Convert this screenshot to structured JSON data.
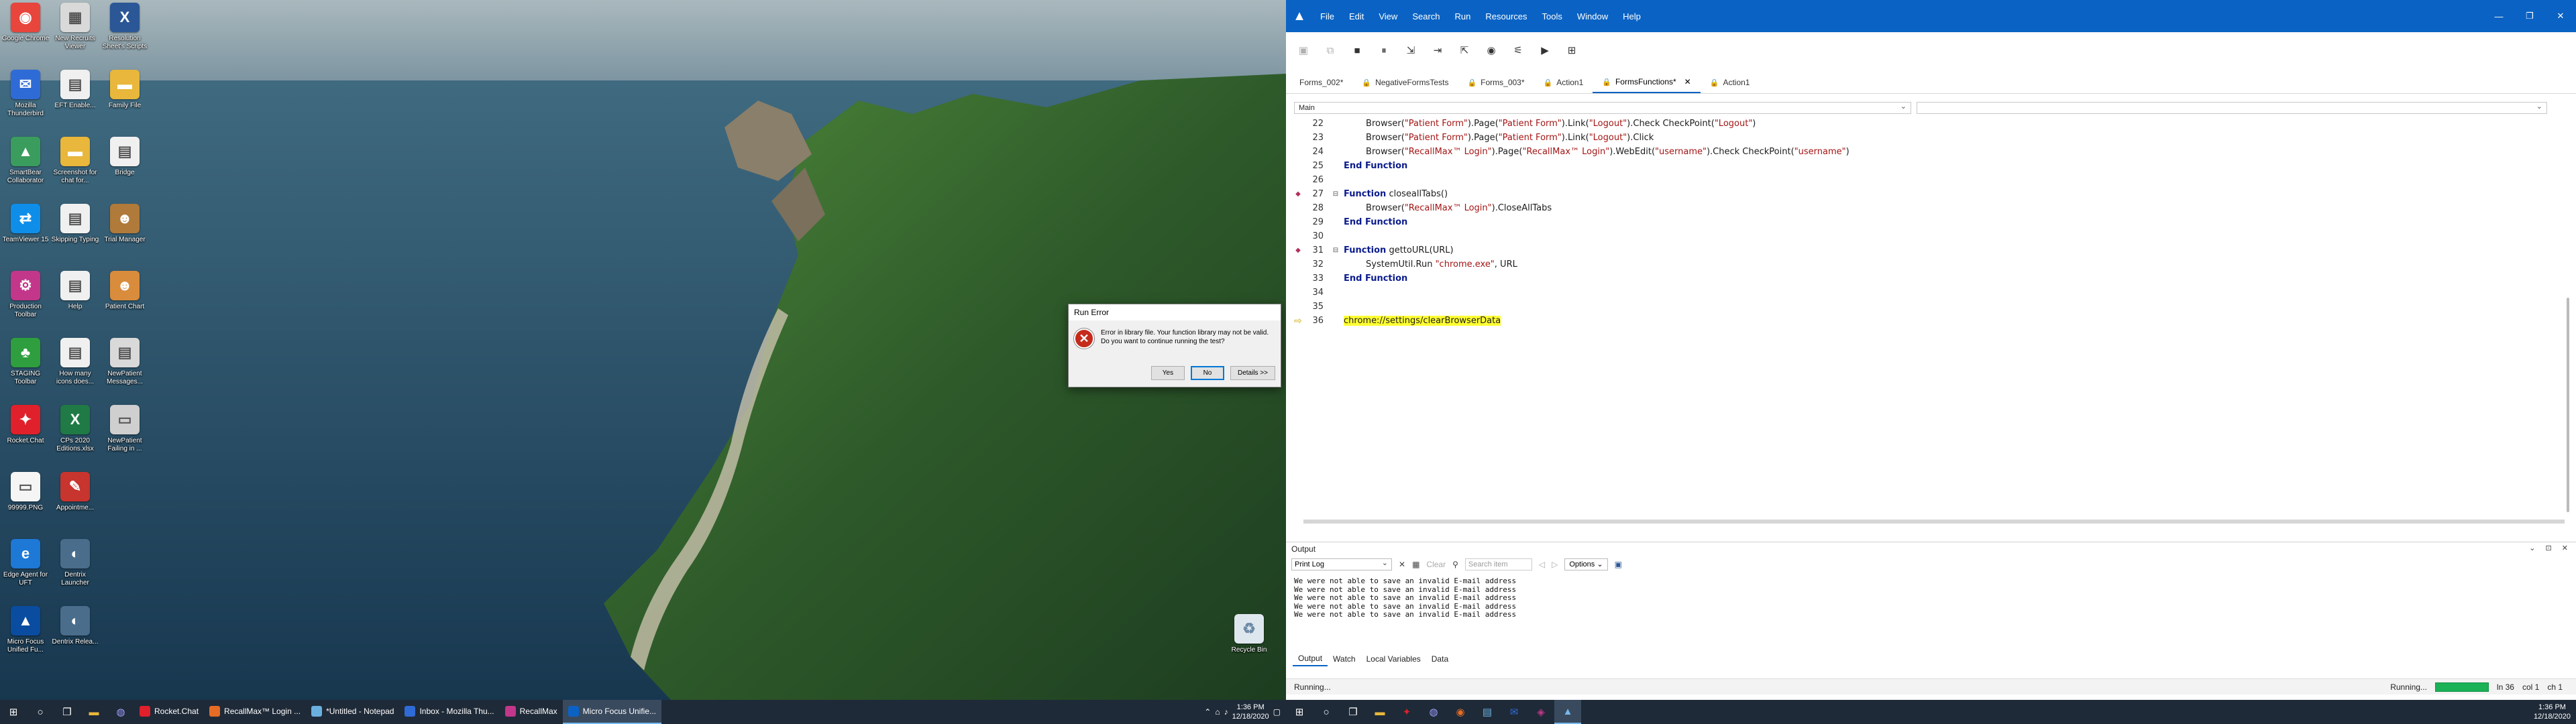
{
  "desktop": {
    "icons": [
      {
        "label": "Google Chrome",
        "icon": "chrome-icon",
        "color": "#e8453c",
        "glyph": "◉"
      },
      {
        "label": "New Recruits Viewer",
        "icon": "spreadsheet-icon",
        "color": "#d9d9d9",
        "glyph": "▦"
      },
      {
        "label": "Resolution Sheet's Scripts",
        "icon": "x-app-icon",
        "color": "#2b5797",
        "glyph": "X"
      },
      {
        "label": "Mozilla Thunderbird",
        "icon": "thunderbird-icon",
        "color": "#2f6bd6",
        "glyph": "✉"
      },
      {
        "label": "EFT Enable...",
        "icon": "document-icon",
        "color": "#f0f0f0",
        "glyph": "▤"
      },
      {
        "label": "Family File",
        "icon": "folder-icon",
        "color": "#e8b73b",
        "glyph": "▬"
      },
      {
        "label": "SmartBear Collaborator",
        "icon": "smartbear-icon",
        "color": "#3a9d5d",
        "glyph": "▲"
      },
      {
        "label": "Screenshot for chat for...",
        "icon": "folder-icon",
        "color": "#e8b73b",
        "glyph": "▬"
      },
      {
        "label": "Bridge",
        "icon": "document-icon",
        "color": "#f0f0f0",
        "glyph": "▤"
      },
      {
        "label": "TeamViewer 15",
        "icon": "teamviewer-icon",
        "color": "#0e8ee9",
        "glyph": "⇄"
      },
      {
        "label": "Skipping Typing",
        "icon": "document-icon",
        "color": "#f0f0f0",
        "glyph": "▤"
      },
      {
        "label": "Trial Manager",
        "icon": "person-icon",
        "color": "#b07a3a",
        "glyph": "☻"
      },
      {
        "label": "Production Toolbar",
        "icon": "production-icon",
        "color": "#c2378a",
        "glyph": "⚙"
      },
      {
        "label": "Help",
        "icon": "document-icon",
        "color": "#f0f0f0",
        "glyph": "▤"
      },
      {
        "label": "Patient Chart",
        "icon": "person-icon",
        "color": "#d98c3c",
        "glyph": "☻"
      },
      {
        "label": "STAGING Toolbar",
        "icon": "tree-icon",
        "color": "#2e9e3e",
        "glyph": "♣"
      },
      {
        "label": "How many icons does...",
        "icon": "document-icon",
        "color": "#f0f0f0",
        "glyph": "▤"
      },
      {
        "label": "NewPatient Messages...",
        "icon": "document-icon",
        "color": "#d9d9d9",
        "glyph": "▤"
      },
      {
        "label": "Rocket.Chat",
        "icon": "rocketchat-icon",
        "color": "#e0202a",
        "glyph": "✦"
      },
      {
        "label": "CPs 2020 Editions.xlsx",
        "icon": "excel-icon",
        "color": "#1f7a45",
        "glyph": "X"
      },
      {
        "label": "NewPatient Failing in ...",
        "icon": "image-icon",
        "color": "#cfcfcf",
        "glyph": "▭"
      },
      {
        "label": "99999.PNG",
        "icon": "image-icon",
        "color": "#f5f5f5",
        "glyph": "▭"
      },
      {
        "label": "Appointme...",
        "icon": "appointment-icon",
        "color": "#c8342e",
        "glyph": "✎"
      },
      {
        "label": "Edge Agent for UFT",
        "icon": "edge-icon",
        "color": "#1d78d6",
        "glyph": "e"
      },
      {
        "label": "Dentrix Launcher",
        "icon": "dentrix-icon",
        "color": "#4a6d8c",
        "glyph": "◐"
      },
      {
        "label": "Micro Focus Unified Fu...",
        "icon": "microfocus-icon",
        "color": "#0a4ca0",
        "glyph": "▲"
      },
      {
        "label": "Dentrix Relea...",
        "icon": "dentrix-icon",
        "color": "#4a6d8c",
        "glyph": "◐"
      }
    ],
    "recycle_bin": "Recycle Bin"
  },
  "dialog": {
    "title": "Run Error",
    "message": "Error in library file. Your function library may not be valid.\nDo you want to continue running the test?",
    "yes": "Yes",
    "no": "No",
    "details": "Details >>"
  },
  "taskbar_left": {
    "apps": [
      {
        "label": "Rocket.Chat",
        "color": "#e0202a"
      },
      {
        "label": "RecallMax™ Login ...",
        "color": "#e66b24"
      },
      {
        "label": "*Untitled - Notepad",
        "color": "#6ab0de"
      },
      {
        "label": "Inbox - Mozilla Thu...",
        "color": "#2f6bd6"
      },
      {
        "label": "RecallMax",
        "color": "#c2378a"
      },
      {
        "label": "Micro Focus Unifie...",
        "color": "#0a63c4"
      }
    ],
    "time": "1:36 PM",
    "date": "12/18/2020"
  },
  "app": {
    "menu": [
      "File",
      "Edit",
      "View",
      "Search",
      "Run",
      "Resources",
      "Tools",
      "Window",
      "Help"
    ],
    "tabs": [
      {
        "label": "Forms_002*",
        "locked": false,
        "close": false
      },
      {
        "label": "NegativeFormsTests",
        "locked": true,
        "close": false
      },
      {
        "label": "Forms_003*",
        "locked": true,
        "close": false
      },
      {
        "label": "Action1",
        "locked": true,
        "close": false
      },
      {
        "label": "FormsFunctions*",
        "locked": true,
        "close": true
      },
      {
        "label": "Action1",
        "locked": true,
        "close": false
      }
    ],
    "scope_dropdown": "Main",
    "code": [
      {
        "n": "22",
        "parts": [
          [
            "",
            "        Browser("
          ],
          [
            "s",
            "\"Patient Form\""
          ],
          [
            "",
            ").Page("
          ],
          [
            "s",
            "\"Patient Form\""
          ],
          [
            "",
            ").Link("
          ],
          [
            "s",
            "\"Logout\""
          ],
          [
            "",
            ").Check CheckPoint("
          ],
          [
            "s",
            "\"Logout\""
          ],
          [
            "",
            ")"
          ]
        ]
      },
      {
        "n": "23",
        "parts": [
          [
            "",
            "        Browser("
          ],
          [
            "s",
            "\"Patient Form\""
          ],
          [
            "",
            ").Page("
          ],
          [
            "s",
            "\"Patient Form\""
          ],
          [
            "",
            ").Link("
          ],
          [
            "s",
            "\"Logout\""
          ],
          [
            "",
            ").Click"
          ]
        ]
      },
      {
        "n": "24",
        "parts": [
          [
            "",
            "        Browser("
          ],
          [
            "s",
            "\"RecallMax™ Login\""
          ],
          [
            "",
            ").Page("
          ],
          [
            "s",
            "\"RecallMax™ Login\""
          ],
          [
            "",
            ").WebEdit("
          ],
          [
            "s",
            "\"username\""
          ],
          [
            "",
            ").Check CheckPoint("
          ],
          [
            "s",
            "\"username\""
          ],
          [
            "",
            ")"
          ]
        ]
      },
      {
        "n": "25",
        "parts": [
          [
            "k",
            "End Function"
          ]
        ]
      },
      {
        "n": "26",
        "parts": []
      },
      {
        "n": "27",
        "bp": true,
        "fold": true,
        "parts": [
          [
            "k",
            "Function"
          ],
          [
            "",
            " closeallTabs()"
          ]
        ]
      },
      {
        "n": "28",
        "parts": [
          [
            "",
            "        Browser("
          ],
          [
            "s",
            "\"RecallMax™ Login\""
          ],
          [
            "",
            ").CloseAllTabs"
          ]
        ]
      },
      {
        "n": "29",
        "parts": [
          [
            "k",
            "End Function"
          ]
        ]
      },
      {
        "n": "30",
        "parts": []
      },
      {
        "n": "31",
        "bp": true,
        "fold": true,
        "parts": [
          [
            "k",
            "Function"
          ],
          [
            "",
            " gettoURL(URL)"
          ]
        ]
      },
      {
        "n": "32",
        "parts": [
          [
            "",
            "        SystemUtil.Run "
          ],
          [
            "s",
            "\"chrome.exe\""
          ],
          [
            "",
            ", URL"
          ]
        ]
      },
      {
        "n": "33",
        "parts": [
          [
            "k",
            "End Function"
          ]
        ]
      },
      {
        "n": "34",
        "parts": []
      },
      {
        "n": "35",
        "parts": []
      },
      {
        "n": "36",
        "arrow": true,
        "parts": [
          [
            "h",
            "chrome://settings/clearBrowserData"
          ]
        ]
      }
    ],
    "output": {
      "title": "Output",
      "select": "Print Log",
      "clear": "Clear",
      "search_placeholder": "Search item",
      "options": "Options",
      "lines": [
        "We were not able to save an invalid E-mail address",
        "We were not able to save an invalid E-mail address",
        "We were not able to save an invalid E-mail address",
        "We were not able to save an invalid E-mail address",
        "We were not able to save an invalid E-mail address"
      ],
      "tabs": [
        "Output",
        "Watch",
        "Local Variables",
        "Data"
      ]
    },
    "status": {
      "left": "Running...",
      "right_label": "Running...",
      "line": "ln 36",
      "col": "col 1",
      "ch": "ch 1"
    }
  },
  "taskbar_right": {
    "time": "1:36 PM",
    "date": "12/18/2020"
  }
}
